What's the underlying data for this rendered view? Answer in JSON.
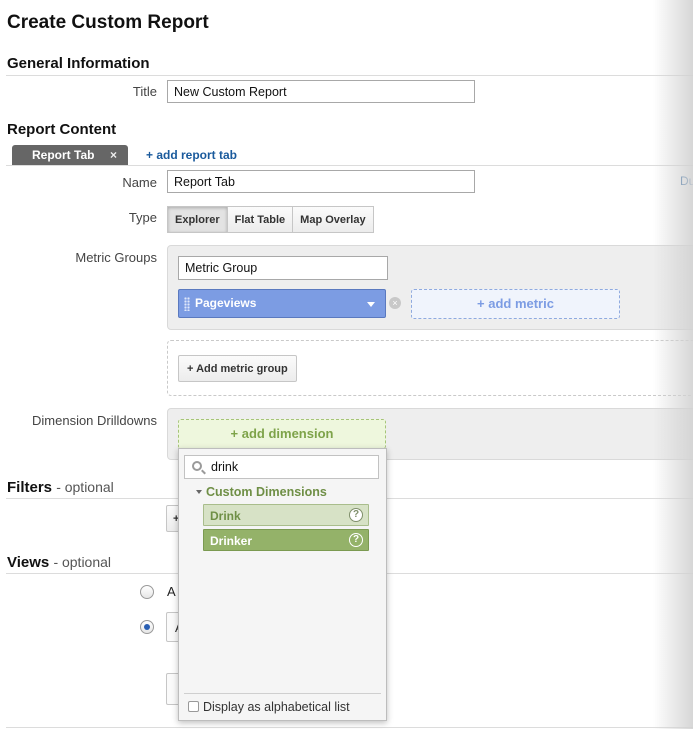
{
  "page_title": "Create Custom Report",
  "general": {
    "heading": "General Information",
    "title_label": "Title",
    "title_value": "New Custom Report"
  },
  "content": {
    "heading": "Report Content",
    "tab_label": "Report Tab",
    "tab_close": "×",
    "add_tab": "+ add report tab",
    "name_label": "Name",
    "name_value": "Report Tab",
    "right_link_partial": "Du",
    "type_label": "Type",
    "type_options": [
      "Explorer",
      "Flat Table",
      "Map Overlay"
    ],
    "type_selected": "Explorer",
    "metric_groups_label": "Metric Groups",
    "metric_group_name": "Metric Group",
    "metric_chip": "Pageviews",
    "metric_clear": "×",
    "add_metric": "+ add metric",
    "add_metric_group": "+ Add metric group",
    "drilldowns_label": "Dimension Drilldowns",
    "add_dimension": "+ add dimension"
  },
  "dimension_dropdown": {
    "search_value": "drink",
    "group_label": "Custom Dimensions",
    "items": [
      {
        "label": "Drink",
        "help": "?"
      },
      {
        "label": "Drinker",
        "help": "?"
      }
    ],
    "alpha_label": "Display as alphabetical list"
  },
  "filters": {
    "heading": "Filters",
    "optional": "- optional",
    "partial_button": "+"
  },
  "views": {
    "heading": "Views",
    "optional": "- optional",
    "radio_all_partial": "A",
    "radio_selected_partial": "A"
  },
  "colors": {
    "metric_blue": "#7c9ce3",
    "dimension_green": "#94b269",
    "link_blue": "#1a5a9c"
  }
}
